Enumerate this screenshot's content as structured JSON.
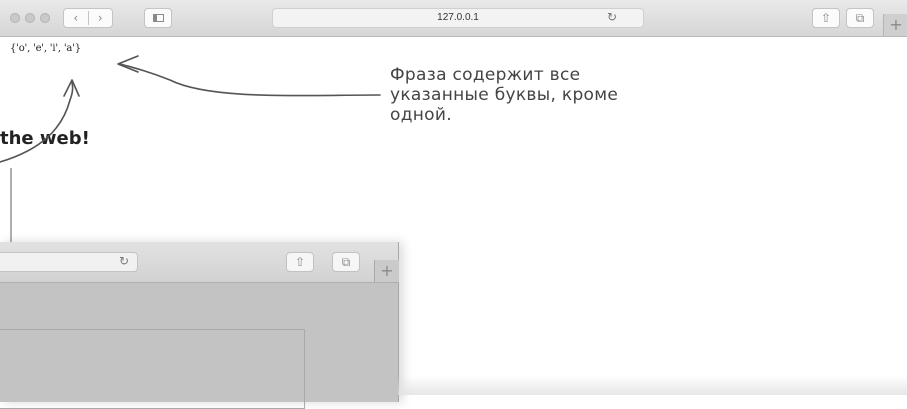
{
  "front_window": {
    "address": "127.0.0.1",
    "icons": {
      "back": "chevron-left-icon",
      "forward": "chevron-right-icon",
      "sidebar": "sidebar-icon",
      "reload": "reload-icon",
      "share": "share-icon",
      "tabs": "tabs-icon",
      "new_tab": "plus-icon"
    },
    "glyphs": {
      "back": "‹",
      "forward": "›",
      "reload": "↻",
      "share": "⇧",
      "tabs": "⧉",
      "new_tab": "+"
    },
    "page_output": "{'o', 'e', 'i', 'a'}"
  },
  "annotation": {
    "lines": [
      "Фраза содержит все",
      "указанные буквы, кроме",
      "одной."
    ]
  },
  "back_window": {
    "heading_fragment": "the web!",
    "glyphs": {
      "reload": "↻",
      "share": "⇧",
      "tabs": "⧉",
      "new_tab": "+"
    }
  },
  "colors": {
    "toolbar": "#d6d6d6",
    "background": "#ffffff",
    "back_window": "#c3c3c3",
    "ink": "#444444"
  }
}
